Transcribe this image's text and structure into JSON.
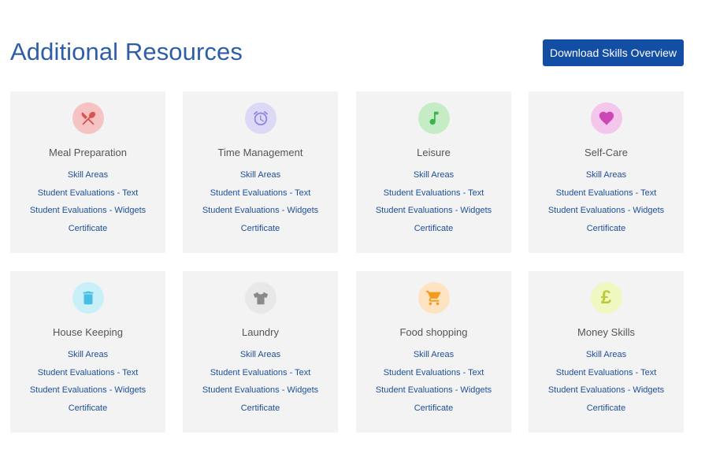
{
  "header": {
    "title": "Additional Resources",
    "download_label": "Download Skills Overview"
  },
  "cards": [
    {
      "title": "Meal Preparation",
      "icon": "fork-knife-icon",
      "icon_bg": "#f6c3c3",
      "icon_color": "#d9534f",
      "links": [
        "Skill Areas",
        "Student Evaluations - Text",
        "Student Evaluations - Widgets",
        "Certificate"
      ]
    },
    {
      "title": "Time Management",
      "icon": "alarm-clock-icon",
      "icon_bg": "#dcd9f7",
      "icon_color": "#8f87df",
      "links": [
        "Skill Areas",
        "Student Evaluations - Text",
        "Student Evaluations - Widgets",
        "Certificate"
      ]
    },
    {
      "title": "Leisure",
      "icon": "music-note-icon",
      "icon_bg": "#c6ecc6",
      "icon_color": "#3bb54a",
      "links": [
        "Skill Areas",
        "Student Evaluations - Text",
        "Student Evaluations - Widgets",
        "Certificate"
      ]
    },
    {
      "title": "Self-Care",
      "icon": "heart-icon",
      "icon_bg": "#f4c6ec",
      "icon_color": "#cc49b5",
      "links": [
        "Skill Areas",
        "Student Evaluations - Text",
        "Student Evaluations - Widgets",
        "Certificate"
      ]
    },
    {
      "title": "House Keeping",
      "icon": "trash-can-icon",
      "icon_bg": "#c9f0f8",
      "icon_color": "#46bfe0",
      "links": [
        "Skill Areas",
        "Student Evaluations - Text",
        "Student Evaluations - Widgets",
        "Certificate"
      ]
    },
    {
      "title": "Laundry",
      "icon": "t-shirt-icon",
      "icon_bg": "#e8e8e8",
      "icon_color": "#8a8a8a",
      "links": [
        "Skill Areas",
        "Student Evaluations - Text",
        "Student Evaluations - Widgets",
        "Certificate"
      ]
    },
    {
      "title": "Food shopping",
      "icon": "shopping-cart-icon",
      "icon_bg": "#fde3c2",
      "icon_color": "#f29b1c",
      "links": [
        "Skill Areas",
        "Student Evaluations - Text",
        "Student Evaluations - Widgets",
        "Certificate"
      ]
    },
    {
      "title": "Money Skills",
      "icon": "pound-sign-icon",
      "icon_bg": "#f1f7c0",
      "icon_color": "#bcc93a",
      "glyph": "£",
      "links": [
        "Skill Areas",
        "Student Evaluations - Text",
        "Student Evaluations - Widgets",
        "Certificate"
      ]
    }
  ]
}
